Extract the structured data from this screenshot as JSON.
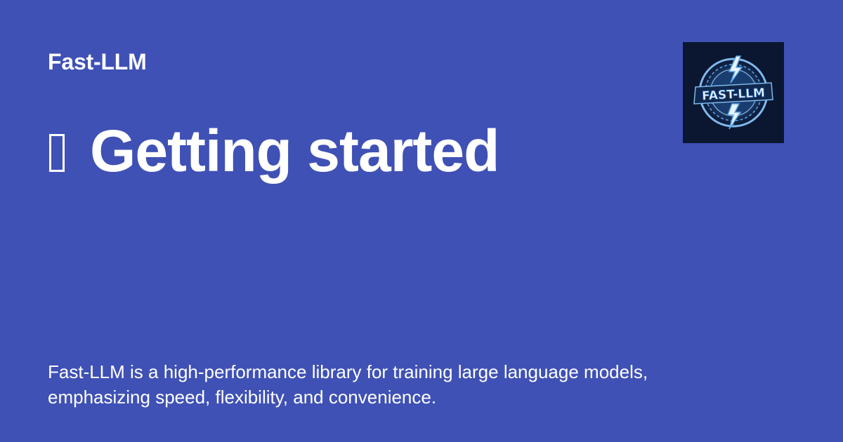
{
  "site": {
    "name": "Fast-LLM"
  },
  "page": {
    "icon": "rocket-icon",
    "title": "Getting started",
    "description": "Fast-LLM is a high-performance library for training large language models, emphasizing speed, flexibility, and convenience."
  },
  "logo": {
    "text": "FAST-LLM",
    "icon": "lightning-bolt-icon"
  },
  "colors": {
    "background": "#3f51b5",
    "text": "#ffffff",
    "logo_background": "#0b1630",
    "logo_accent": "#5fa8e8"
  }
}
